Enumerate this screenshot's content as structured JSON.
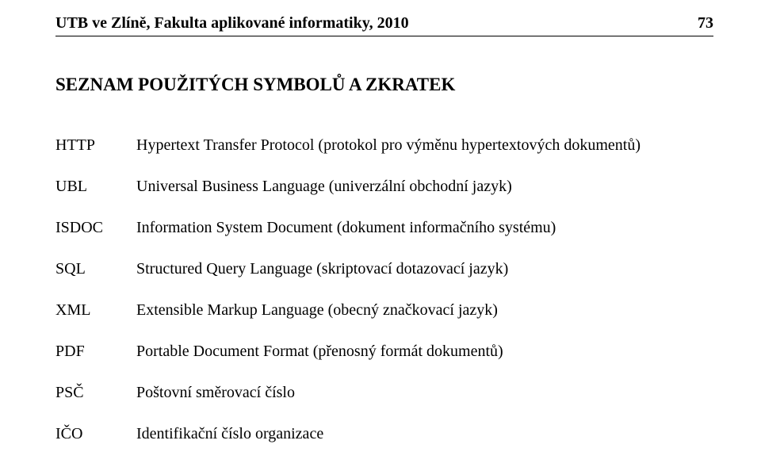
{
  "header": {
    "title": "UTB ve Zlíně, Fakulta aplikované informatiky, 2010",
    "page_number": "73"
  },
  "section_title": "SEZNAM POUŽITÝCH SYMBOLŮ A ZKRATEK",
  "definitions": [
    {
      "abbr": "HTTP",
      "text": "Hypertext Transfer Protocol (protokol pro výměnu hypertextových dokumentů)"
    },
    {
      "abbr": "UBL",
      "text": "Universal Business Language (univerzální obchodní jazyk)"
    },
    {
      "abbr": "ISDOC",
      "text": "Information System Document (dokument informačního systému)"
    },
    {
      "abbr": "SQL",
      "text": "Structured Query Language (skriptovací dotazovací jazyk)"
    },
    {
      "abbr": "XML",
      "text": "Extensible Markup Language (obecný značkovací jazyk)"
    },
    {
      "abbr": "PDF",
      "text": "Portable Document Format (přenosný formát dokumentů)"
    },
    {
      "abbr": "PSČ",
      "text": "Poštovní směrovací číslo"
    },
    {
      "abbr": "IČO",
      "text": "Identifikační číslo organizace"
    }
  ]
}
